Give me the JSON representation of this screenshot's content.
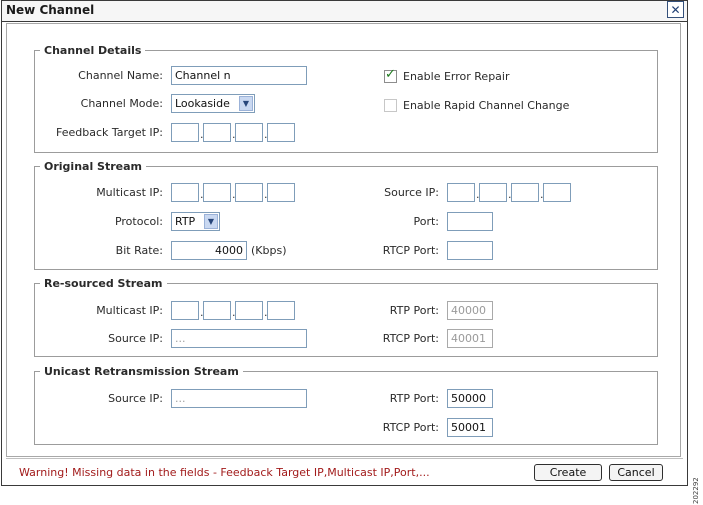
{
  "dialog": {
    "title": "New Channel",
    "close_glyph": "✕"
  },
  "channel_details": {
    "title": "Channel Details",
    "channel_name_label": "Channel Name:",
    "channel_name_value": "Channel n",
    "channel_mode_label": "Channel Mode:",
    "channel_mode_value": "Lookaside",
    "feedback_target_ip_label": "Feedback Target IP:",
    "enable_error_repair_label": "Enable Error Repair",
    "enable_error_repair_checked": true,
    "enable_rapid_channel_change_label": "Enable Rapid Channel Change",
    "enable_rapid_channel_change_checked": false
  },
  "original_stream": {
    "title": "Original Stream",
    "multicast_ip_label": "Multicast IP:",
    "source_ip_label": "Source IP:",
    "protocol_label": "Protocol:",
    "protocol_value": "RTP",
    "port_label": "Port:",
    "bit_rate_label": "Bit Rate:",
    "bit_rate_value": "4000",
    "bit_rate_unit": "(Kbps)",
    "rtcp_port_label": "RTCP Port:"
  },
  "resourced_stream": {
    "title": "Re-sourced Stream",
    "multicast_ip_label": "Multicast IP:",
    "source_ip_label": "Source IP:",
    "source_ip_placeholder": "...",
    "rtp_port_label": "RTP Port:",
    "rtp_port_value": "40000",
    "rtcp_port_label": "RTCP Port:",
    "rtcp_port_value": "40001"
  },
  "unicast_stream": {
    "title": "Unicast Retransmission Stream",
    "source_ip_label": "Source IP:",
    "source_ip_placeholder": "...",
    "rtp_port_label": "RTP Port:",
    "rtp_port_value": "50000",
    "rtcp_port_label": "RTCP Port:",
    "rtcp_port_value": "50001"
  },
  "footer": {
    "warning": "Warning! Missing data in the fields - Feedback Target IP,Multicast IP,Port,...",
    "create_label": "Create",
    "cancel_label": "Cancel"
  },
  "figure_id": "202292",
  "colors": {
    "warning": "#a21b1b",
    "checkmark": "#1d7a1d",
    "field_border": "#7f9db9"
  }
}
